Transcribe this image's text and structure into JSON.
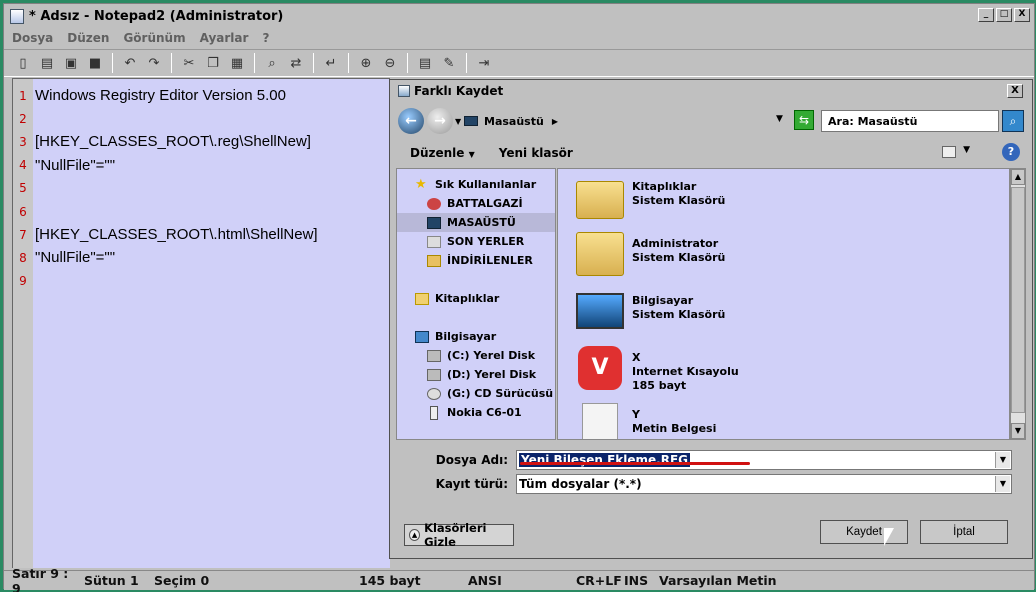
{
  "window": {
    "title": "* Adsız - Notepad2 (Administrator)",
    "btn_min": "_",
    "btn_max": "□",
    "btn_close": "X"
  },
  "menu": [
    "Dosya",
    "Düzen",
    "Görünüm",
    "Ayarlar",
    "?"
  ],
  "editor": {
    "lines": [
      {
        "n": "1",
        "t": "Windows Registry Editor Version 5.00"
      },
      {
        "n": "2",
        "t": ""
      },
      {
        "n": "3",
        "t": "[HKEY_CLASSES_ROOT\\.reg\\ShellNew]"
      },
      {
        "n": "4",
        "t": "\"NullFile\"=\"\""
      },
      {
        "n": "5",
        "t": ""
      },
      {
        "n": "6",
        "t": ""
      },
      {
        "n": "7",
        "t": "[HKEY_CLASSES_ROOT\\.html\\ShellNew]"
      },
      {
        "n": "8",
        "t": "\"NullFile\"=\"\""
      },
      {
        "n": "9",
        "t": ""
      }
    ]
  },
  "status": {
    "line_col": "Satır 9 : 9",
    "column": "Sütun 1",
    "selection": "Seçim 0",
    "size": "145 bayt",
    "encoding": "ANSI",
    "eol": "CR+LF",
    "ins": "INS",
    "scheme": "Varsayılan Metin"
  },
  "dialog": {
    "title": "Farklı Kaydet",
    "close": "X",
    "address": "Masaüstü",
    "search_placeholder": "Ara: Masaüstü",
    "organize": "Düzenle",
    "new_folder": "Yeni klasör",
    "help": "?",
    "nav": {
      "favorites": "Sık Kullanılanlar",
      "fav_items": [
        "BATTALGAZİ",
        "MASAÜSTÜ",
        "SON YERLER",
        "İNDİRİLENLER"
      ],
      "libraries": "Kitaplıklar",
      "computer": "Bilgisayar",
      "drives": [
        "(C:) Yerel Disk",
        "(D:) Yerel Disk",
        "(G:) CD Sürücüsü",
        "Nokia C6-01"
      ]
    },
    "files": [
      {
        "name": "Kitaplıklar",
        "type": "Sistem Klasörü",
        "extra": ""
      },
      {
        "name": "Administrator",
        "type": "Sistem Klasörü",
        "extra": ""
      },
      {
        "name": "Bilgisayar",
        "type": "Sistem Klasörü",
        "extra": ""
      },
      {
        "name": "X",
        "type": "Internet Kısayolu",
        "extra": "185 bayt"
      },
      {
        "name": "Y",
        "type": "Metin Belgesi",
        "extra": ""
      }
    ],
    "filename_label": "Dosya Adı:",
    "filename_value": "Yeni Bileşen Ekleme.REG",
    "filetype_label": "Kayıt türü:",
    "filetype_value": "Tüm dosyalar (*.*)",
    "hide_folders": "Klasörleri Gizle",
    "save": "Kaydet",
    "cancel": "İptal"
  },
  "colors": {
    "editor_bg": "#d0d0f8",
    "line_number": "#c00000",
    "selection": "#0a246a",
    "underline": "#d01010"
  }
}
